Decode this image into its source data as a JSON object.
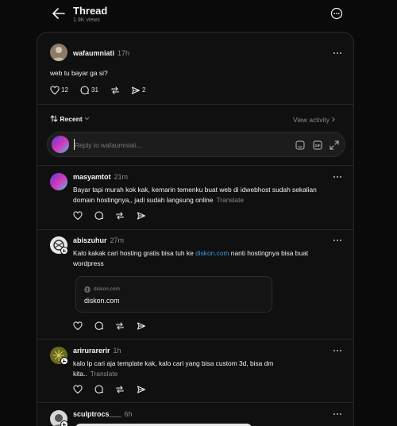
{
  "header": {
    "title": "Thread",
    "views": "1.9K views"
  },
  "post": {
    "author": "wafaumniati",
    "time": "17h",
    "text": "web tu bayar ga si?",
    "likes": "12",
    "comments": "31",
    "shares": "2"
  },
  "sort": {
    "label": "Recent",
    "view_activity": "View activity"
  },
  "reply": {
    "placeholder": "Reply to wafaumniati..."
  },
  "replies": [
    {
      "author": "masyamtot",
      "time": "21m",
      "text": "Bayar tapi murah kok kak, kemarin temenku buat web di idwebhost sudah sekalian domain hostingnya,, jadi sudah langsung online",
      "translate": "Translate"
    },
    {
      "author": "abiszuhur",
      "time": "27m",
      "text_before": "Kalo kakak cari hosting gratis bisa tuh ke",
      "link": "diskon.com",
      "text_after": "nanti hostingnya bisa buat wordpress",
      "card_domain": "diskon.com",
      "card_title": "diskon.com"
    },
    {
      "author": "arirurarerir",
      "time": "1h",
      "text": "kalo lp cari aja template kak, kalo cari yang bisa custom 3d, bisa dm kita..",
      "translate": "Translate"
    },
    {
      "author": "sculptrocs___",
      "time": "6h"
    }
  ],
  "colors": {
    "background": "#0a0a0a",
    "panel": "#101010",
    "link": "#3a9de8",
    "muted": "#8a8a8a"
  },
  "icons": [
    "back-arrow-icon",
    "more-options-icon",
    "heart-icon",
    "comment-icon",
    "repost-icon",
    "share-icon",
    "sort-icon",
    "chevron-down-icon",
    "chevron-right-icon",
    "sticker-icon",
    "gif-icon",
    "expand-icon",
    "globe-icon"
  ]
}
